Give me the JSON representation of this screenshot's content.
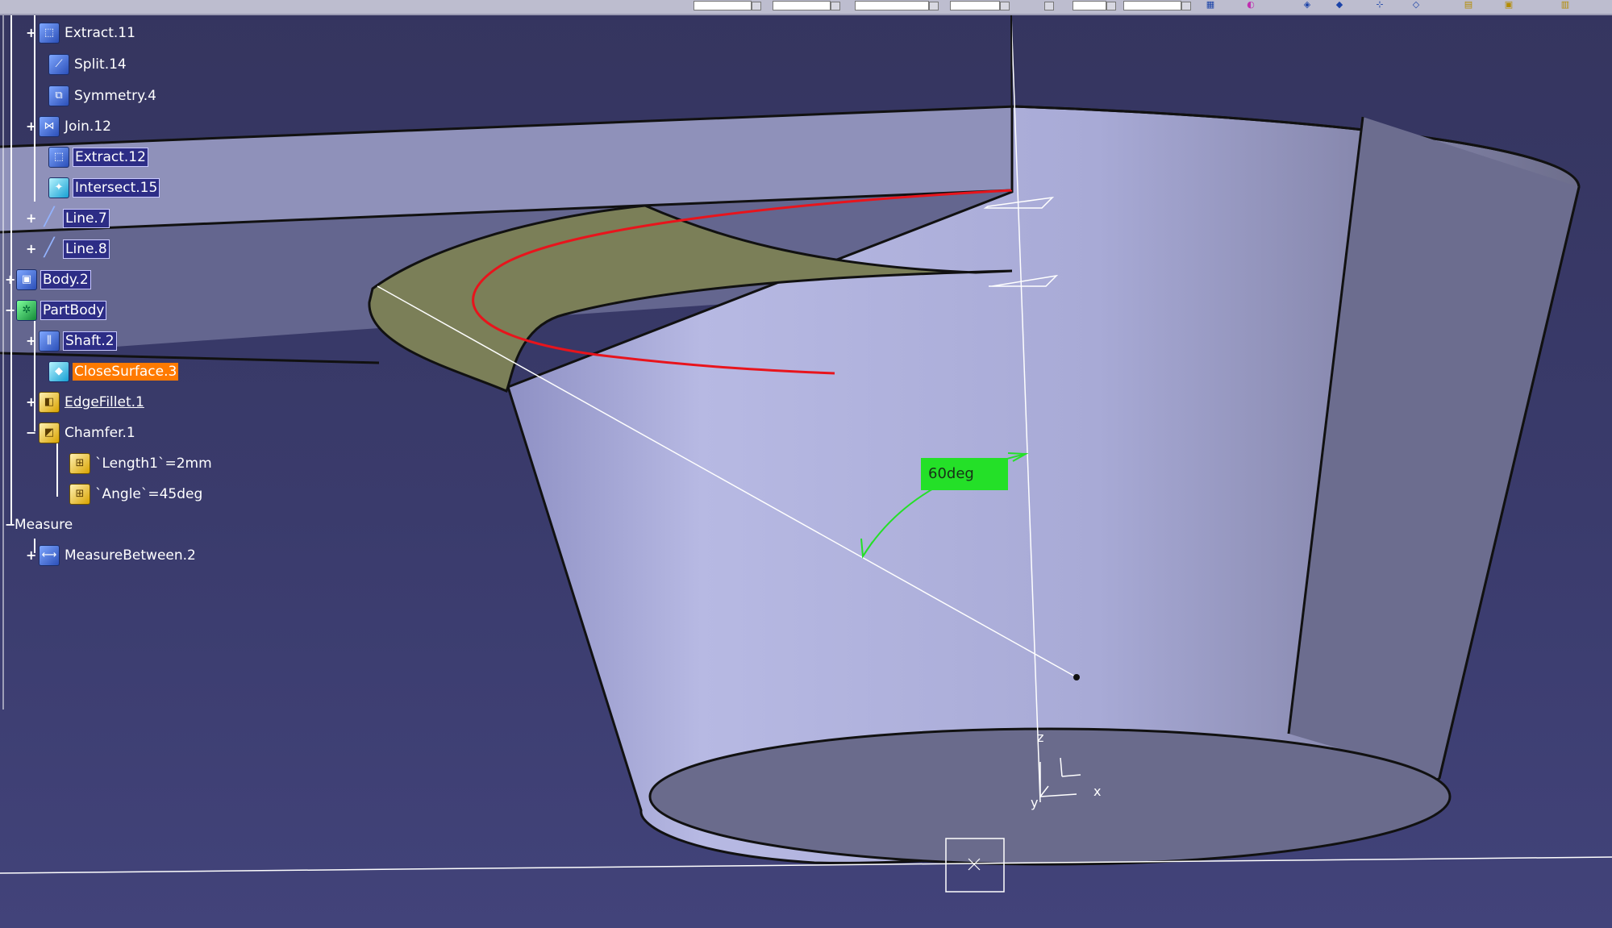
{
  "tree": {
    "items": [
      {
        "label": "Extract.11",
        "icon": "extract-icon",
        "style": "plain"
      },
      {
        "label": "Split.14",
        "icon": "split-icon",
        "style": "plain"
      },
      {
        "label": "Symmetry.4",
        "icon": "symmetry-icon",
        "style": "plain"
      },
      {
        "label": "Join.12",
        "icon": "join-icon",
        "style": "plain"
      },
      {
        "label": "Extract.12",
        "icon": "extract-icon",
        "style": "selected"
      },
      {
        "label": "Intersect.15",
        "icon": "intersect-icon",
        "style": "selected"
      },
      {
        "label": "Line.7",
        "icon": "line-icon",
        "style": "selected"
      },
      {
        "label": "Line.8",
        "icon": "line-icon",
        "style": "selected"
      },
      {
        "label": "Body.2",
        "icon": "body-icon",
        "style": "selected"
      },
      {
        "label": "PartBody",
        "icon": "partbody-icon",
        "style": "selected"
      },
      {
        "label": "Shaft.2",
        "icon": "shaft-icon",
        "style": "selected"
      },
      {
        "label": "CloseSurface.3",
        "icon": "close-surface-icon",
        "style": "highlighted"
      },
      {
        "label": "EdgeFillet.1",
        "icon": "edge-fillet-icon",
        "style": "underlined"
      },
      {
        "label": "Chamfer.1",
        "icon": "chamfer-icon",
        "style": "plain"
      },
      {
        "label": "`Length1`=2mm",
        "icon": "parameter-icon",
        "style": "plain"
      },
      {
        "label": "`Angle`=45deg",
        "icon": "parameter-icon",
        "style": "plain"
      },
      {
        "label": "Measure",
        "icon": "",
        "style": "plain"
      },
      {
        "label": "MeasureBetween.2",
        "icon": "measure-between-icon",
        "style": "plain"
      }
    ]
  },
  "viewport": {
    "angle_annotation": "60deg",
    "axes": {
      "z": "z",
      "x": "x",
      "y": "y"
    }
  },
  "colors": {
    "background": "#3a3b6c",
    "cone_face": "#aeb0dc",
    "surface_green": "#7b7f58",
    "red_curve": "#e8141c",
    "annotation_green": "#24e028",
    "highlight_orange": "#ff7a00"
  },
  "toolbar": {
    "icons": [
      "grid-icon",
      "magnet-icon",
      "view-icon",
      "render-icon",
      "axis-icon",
      "material-icon",
      "layer-icon"
    ]
  }
}
